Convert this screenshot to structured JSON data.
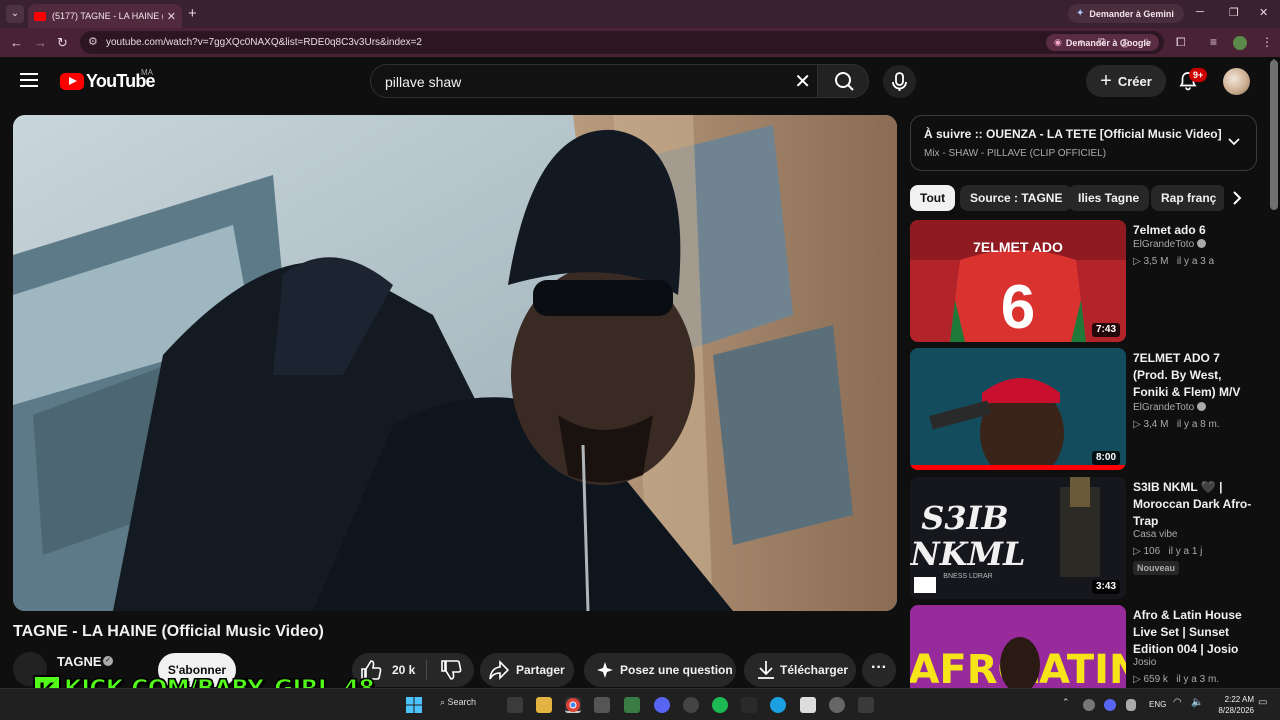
{
  "browser": {
    "tab_title": "(5177) TAGNE - LA HAINE (Offic",
    "gemini_label": "Demander à Gemini",
    "url": "youtube.com/watch?v=7ggXQc0NAXQ&list=RDE0q8C3v3Urs&index=2",
    "ask_google_label": "Demander à Google",
    "accent": "#4a2236"
  },
  "header": {
    "logo_text": "YouTube",
    "country_code": "MA",
    "search_query": "pillave shaw",
    "create_label": "Créer",
    "notification_count": "9+"
  },
  "video": {
    "title": "TAGNE - LA HAINE (Official Music Video)",
    "channel": "TAGNE",
    "subscribe_label": "S'abonner",
    "likes": "20 k",
    "share_label": "Partager",
    "ask_label": "Posez une question",
    "download_label": "Télécharger",
    "overlay_text": "KICK.COM/BABY_GIRL_48",
    "overlay_icon": "K"
  },
  "up_next": {
    "title": "À suivre :: OUENZA - LA TETE [Official Music Video]",
    "subtitle": "Mix - SHAW - PILLAVE (CLIP OFFICIEL)"
  },
  "chips": [
    "Tout",
    "Source : TAGNE",
    "Ilies Tagne",
    "Rap franç"
  ],
  "recommendations": [
    {
      "title": "7elmet ado 6",
      "channel": "ElGrandeToto",
      "verified": true,
      "views": "▷ 3,5 M",
      "age": "il y a 3 a",
      "duration": "7:43",
      "thumb_text": "7ELMET ADO",
      "thumb_number": "6",
      "badge": ""
    },
    {
      "title": "7ELMET ADO 7 (Prod. By West, Foniki & Flem) M/V",
      "channel": "ElGrandeToto",
      "verified": true,
      "views": "▷ 3,4 M",
      "age": "il y a 8 m.",
      "duration": "8:00",
      "thumb_text": "",
      "thumb_number": "",
      "badge": ""
    },
    {
      "title": "S3IB NKML 🖤 | Moroccan Dark Afro-Trap",
      "channel": "Casa vibe",
      "verified": false,
      "views": "▷ 106",
      "age": "il y a 1 j",
      "duration": "3:43",
      "thumb_text": "S3IB",
      "thumb_number": "NKML",
      "thumb_caption": "BNESS LDRAR",
      "badge": "Nouveau"
    },
    {
      "title": "Afro & Latin House Live Set | Sunset Edition 004 | Josio",
      "channel": "Josio",
      "verified": false,
      "views": "▷ 659 k",
      "age": "il y a 3 m.",
      "duration": "",
      "thumb_text": "AFRO",
      "thumb_number": "LATIN",
      "badge": ""
    }
  ],
  "taskbar": {
    "search_label": "Search",
    "language": "ENG",
    "time": "2:22 AM",
    "date": "8/28/2026"
  }
}
